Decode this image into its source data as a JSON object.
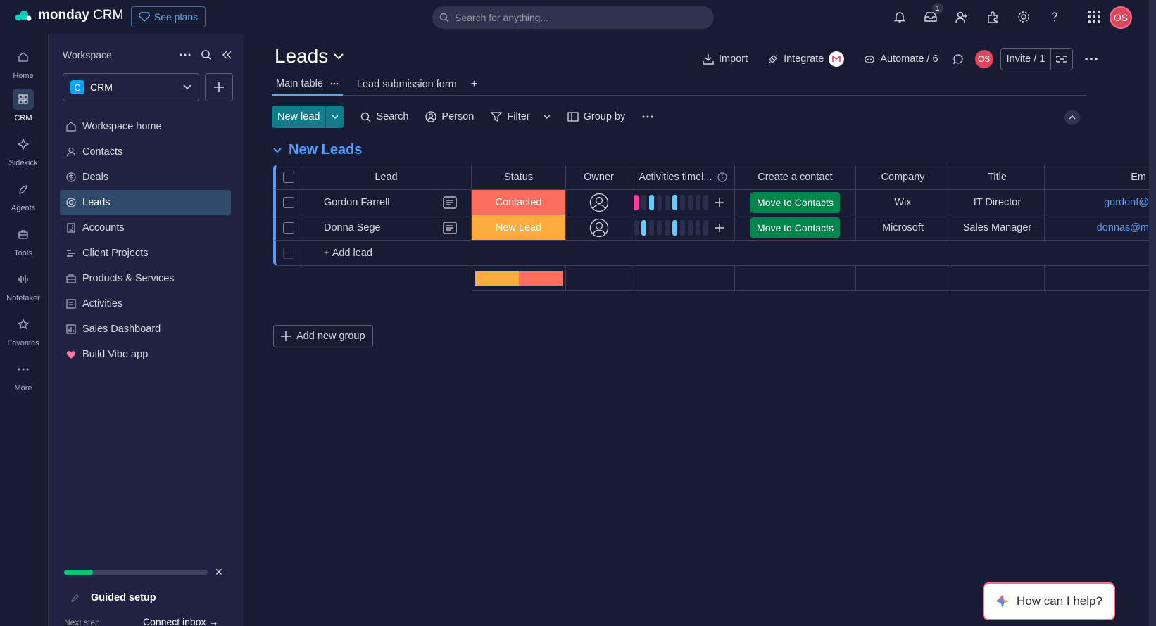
{
  "app": {
    "logo_bold": "monday",
    "logo_rest": " CRM",
    "see_plans": "See plans"
  },
  "search": {
    "placeholder": "Search for anything..."
  },
  "top_icons": [
    "bell-icon",
    "inbox-icon",
    "invite-people-icon",
    "apps-icon",
    "settings-icon",
    "help-icon",
    "grid-icon"
  ],
  "inbox_count": "1",
  "user_initials": "OS",
  "rail": [
    {
      "label": "Home",
      "icon": "home-icon"
    },
    {
      "label": "CRM",
      "icon": "crm-icon"
    },
    {
      "label": "Sidekick",
      "icon": "sidekick-icon"
    },
    {
      "label": "Agents",
      "icon": "agents-icon"
    },
    {
      "label": "Tools",
      "icon": "tools-icon"
    },
    {
      "label": "Notetaker",
      "icon": "notetaker-icon"
    },
    {
      "label": "Favorites",
      "icon": "star-icon"
    },
    {
      "label": "More",
      "icon": "more-icon"
    }
  ],
  "sidebar": {
    "workspace_label": "Workspace",
    "workspace_name": "CRM",
    "workspace_badge": "C",
    "items": [
      {
        "label": "Workspace home",
        "icon": "home-icon"
      },
      {
        "label": "Contacts",
        "icon": "contacts-icon"
      },
      {
        "label": "Deals",
        "icon": "deals-icon"
      },
      {
        "label": "Leads",
        "icon": "leads-icon"
      },
      {
        "label": "Accounts",
        "icon": "accounts-icon"
      },
      {
        "label": "Client Projects",
        "icon": "projects-icon"
      },
      {
        "label": "Products & Services",
        "icon": "products-icon"
      },
      {
        "label": "Activities",
        "icon": "activities-icon"
      },
      {
        "label": "Sales Dashboard",
        "icon": "dashboard-icon"
      },
      {
        "label": "Build Vibe app",
        "icon": "heart-icon"
      }
    ],
    "guided": {
      "title": "Guided setup",
      "next_label": "Next step:",
      "next_action": "Connect inbox →",
      "progress": 0.2
    }
  },
  "board": {
    "title": "Leads",
    "actions": {
      "import": "Import",
      "integrate": "Integrate",
      "automate": "Automate / 6",
      "invite": "Invite / 1"
    },
    "tabs": [
      "Main table",
      "Lead submission form"
    ],
    "toolbar": {
      "new_item": "New lead",
      "search": "Search",
      "person": "Person",
      "filter": "Filter",
      "group_by": "Group by"
    },
    "group": {
      "title": "New Leads",
      "columns": [
        "Lead",
        "Status",
        "Owner",
        "Activities timel...",
        "Create a contact",
        "Company",
        "Title",
        "Em"
      ],
      "rows": [
        {
          "lead": "Gordon Farrell",
          "status": "Contacted",
          "status_color": "#fb6d5d",
          "action": "Move to Contacts",
          "company": "Wix",
          "title": "IT Director",
          "email": "gordonf@"
        },
        {
          "lead": "Donna Sege",
          "status": "New Lead",
          "status_color": "#fdab3d",
          "action": "Move to Contacts",
          "company": "Microsoft",
          "title": "Sales Manager",
          "email": "donnas@m"
        }
      ],
      "add_item": "+ Add lead",
      "status_summary": [
        {
          "color": "#fdab3d",
          "share": 0.5
        },
        {
          "color": "#fb6d5d",
          "share": 0.5
        }
      ]
    },
    "add_group": "Add new group"
  },
  "help": {
    "label": "How can I help?"
  }
}
